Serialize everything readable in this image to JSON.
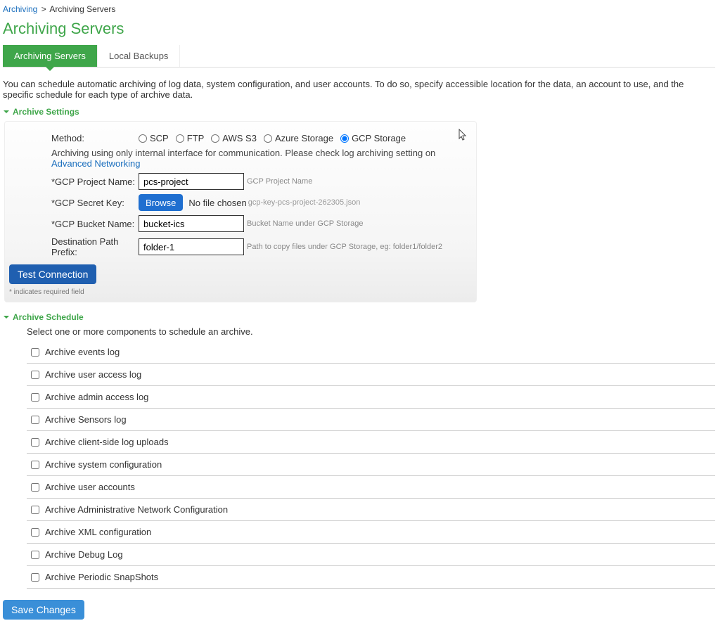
{
  "breadcrumb": {
    "root": "Archiving",
    "sep": ">",
    "current": "Archiving Servers"
  },
  "page_title": "Archiving Servers",
  "tabs": [
    {
      "label": "Archiving Servers",
      "active": true
    },
    {
      "label": "Local Backups",
      "active": false
    }
  ],
  "intro": "You can schedule automatic archiving of log data, system configuration, and user accounts. To do so, specify accessible location for the data, an account to use, and the specific schedule for each type of archive data.",
  "sections": {
    "settings_title": "Archive Settings",
    "schedule_title": "Archive Schedule"
  },
  "settings": {
    "method_label": "Method:",
    "methods": [
      {
        "name": "scp",
        "label": "SCP",
        "selected": false
      },
      {
        "name": "ftp",
        "label": "FTP",
        "selected": false
      },
      {
        "name": "awss3",
        "label": "AWS S3",
        "selected": false
      },
      {
        "name": "azure",
        "label": "Azure Storage",
        "selected": false
      },
      {
        "name": "gcp",
        "label": "GCP Storage",
        "selected": true
      }
    ],
    "interface_hint_prefix": "Archiving using only internal interface for communication. Please check log archiving setting on ",
    "interface_hint_link": "Advanced Networking",
    "project_label": "*GCP Project Name:",
    "project_value": "pcs-project",
    "project_hint": "GCP Project Name",
    "secret_label": "*GCP Secret Key:",
    "browse_label": "Browse",
    "no_file_chosen": "No file chosen",
    "chosen_file": "gcp-key-pcs-project-262305.json",
    "bucket_label": "*GCP Bucket Name:",
    "bucket_value": "bucket-ics",
    "bucket_hint": "Bucket Name under GCP Storage",
    "dest_label": "Destination Path Prefix:",
    "dest_value": "folder-1",
    "dest_hint": "Path to copy files under GCP Storage, eg: folder1/folder2",
    "test_button": "Test Connection",
    "required_note": "* indicates required field"
  },
  "schedule": {
    "intro": "Select one or more components to schedule an archive.",
    "items": [
      "Archive events log",
      "Archive user access log",
      "Archive admin access log",
      "Archive Sensors log",
      "Archive client-side log uploads",
      "Archive system configuration",
      "Archive user accounts",
      "Archive Administrative Network Configuration",
      "Archive XML configuration",
      "Archive Debug Log",
      "Archive Periodic SnapShots"
    ]
  },
  "save_button": "Save Changes"
}
